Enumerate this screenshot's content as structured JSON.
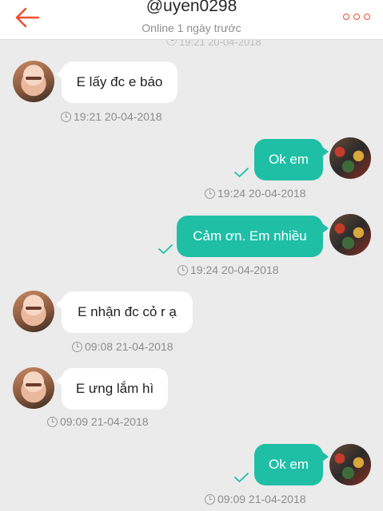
{
  "header": {
    "title": "@uyen0298",
    "subtitle": "Online 1 ngày trước",
    "back_icon": "arrow-left-icon",
    "more_icon": "more-dots-icon",
    "accent_color": "#ee4d2d"
  },
  "faded_timestamp": "19:21 20-04-2018",
  "colors": {
    "outgoing_bubble": "#1fbfa6",
    "incoming_bubble": "#ffffff",
    "background": "#ebebeb"
  },
  "messages": [
    {
      "direction": "incoming",
      "text": "E lấy đc e báo",
      "time": "19:21 20-04-2018"
    },
    {
      "direction": "outgoing",
      "text": "Ok em",
      "time": "19:24 20-04-2018",
      "status": "sent"
    },
    {
      "direction": "outgoing",
      "text": "Cảm ơn. Em nhiều",
      "time": "19:24 20-04-2018",
      "status": "sent"
    },
    {
      "direction": "incoming",
      "text": "E nhận đc cỏ r ạ",
      "time": "09:08 21-04-2018"
    },
    {
      "direction": "incoming",
      "text": "E ưng lắm hì",
      "time": "09:09 21-04-2018"
    },
    {
      "direction": "outgoing",
      "text": "Ok em",
      "time": "09:09 21-04-2018",
      "status": "sent"
    }
  ]
}
